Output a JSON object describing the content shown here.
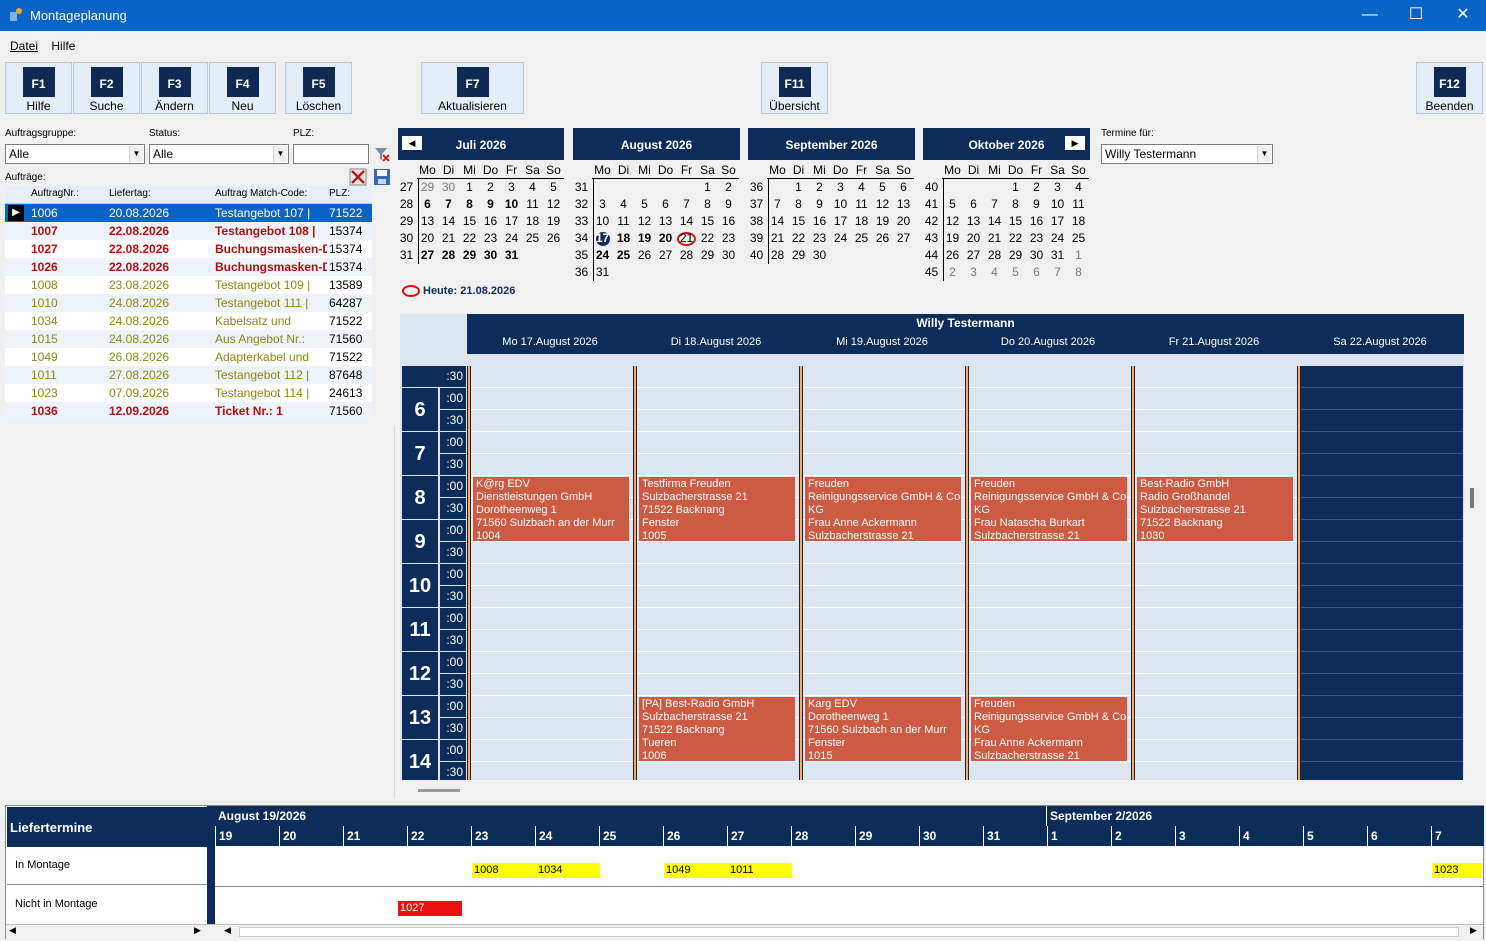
{
  "window": {
    "title": "Montageplanung",
    "min": "—",
    "max": "☐",
    "close": "✕"
  },
  "menu": [
    "Datei",
    "Hilfe"
  ],
  "toolbar": [
    {
      "key": "F1",
      "label": "Hilfe"
    },
    {
      "key": "F2",
      "label": "Suche"
    },
    {
      "key": "F3",
      "label": "Ändern"
    },
    {
      "key": "F4",
      "label": "Neu"
    },
    {
      "key": "F5",
      "label": "Löschen"
    },
    {
      "key": "F7",
      "label": "Aktualisieren"
    },
    {
      "key": "F11",
      "label": "Übersicht"
    },
    {
      "key": "F12",
      "label": "Beenden"
    }
  ],
  "filters": {
    "group_label": "Auftragsgruppe:",
    "group_value": "Alle",
    "status_label": "Status:",
    "status_value": "Alle",
    "plz_label": "PLZ:",
    "plz_value": "",
    "orders_label": "Aufträge:"
  },
  "orders": {
    "columns": [
      "AuftragNr.:",
      "Liefertag:",
      "Auftrag Match-Code:",
      "PLZ:"
    ],
    "rows": [
      [
        "1006",
        "20.08.2026",
        "Testangebot 107 |",
        "71522",
        "selected"
      ],
      [
        "1007",
        "22.08.2026",
        "Testangebot 108 |",
        "15374",
        "red"
      ],
      [
        "1027",
        "22.08.2026",
        "Buchungsmasken-De",
        "15374",
        "red"
      ],
      [
        "1026",
        "22.08.2026",
        "Buchungsmasken-De",
        "15374",
        "red"
      ],
      [
        "1008",
        "23.08.2026",
        "Testangebot 109 |",
        "13589",
        "olive"
      ],
      [
        "1010",
        "24.08.2026",
        "Testangebot 111 |",
        "64287",
        "olive"
      ],
      [
        "1034",
        "24.08.2026",
        "Kabelsatz und",
        "71522",
        "olive"
      ],
      [
        "1015",
        "24.08.2026",
        "Aus Angebot Nr.:",
        "71560",
        "olive"
      ],
      [
        "1049",
        "26.08.2026",
        "Adapterkabel und",
        "71522",
        "olive"
      ],
      [
        "1011",
        "27.08.2026",
        "Testangebot 112 |",
        "87648",
        "olive"
      ],
      [
        "1023",
        "07.09.2026",
        "Testangebot 114 |",
        "24613",
        "olive"
      ],
      [
        "1036",
        "12.09.2026",
        "Ticket Nr.: 1",
        "71560",
        "red"
      ]
    ]
  },
  "calendar": {
    "weekdays": [
      "Mo",
      "Di",
      "Mi",
      "Do",
      "Fr",
      "Sa",
      "So"
    ],
    "months": [
      {
        "title": "Juli 2026",
        "weeks": [
          "27",
          "28",
          "29",
          "30",
          "31"
        ],
        "rows": [
          [
            "29",
            "30",
            "1",
            "2",
            "3",
            "4",
            "5"
          ],
          [
            "6",
            "7",
            "8",
            "9",
            "10",
            "11",
            "12"
          ],
          [
            "13",
            "14",
            "15",
            "16",
            "17",
            "18",
            "19"
          ],
          [
            "20",
            "21",
            "22",
            "23",
            "24",
            "25",
            "26"
          ],
          [
            "27",
            "28",
            "29",
            "30",
            "31",
            "",
            ""
          ]
        ]
      },
      {
        "title": "August 2026",
        "weeks": [
          "31",
          "32",
          "33",
          "34",
          "35",
          "36"
        ],
        "rows": [
          [
            "",
            "",
            "",
            "",
            "",
            "1",
            "2"
          ],
          [
            "3",
            "4",
            "5",
            "6",
            "7",
            "8",
            "9"
          ],
          [
            "10",
            "11",
            "12",
            "13",
            "14",
            "15",
            "16"
          ],
          [
            "17",
            "18",
            "19",
            "20",
            "21",
            "22",
            "23"
          ],
          [
            "24",
            "25",
            "26",
            "27",
            "28",
            "29",
            "30"
          ],
          [
            "31",
            "",
            "",
            "",
            "",
            "",
            ""
          ]
        ]
      },
      {
        "title": "September 2026",
        "weeks": [
          "36",
          "37",
          "38",
          "39",
          "40"
        ],
        "rows": [
          [
            "",
            "1",
            "2",
            "3",
            "4",
            "5",
            "6"
          ],
          [
            "7",
            "8",
            "9",
            "10",
            "11",
            "12",
            "13"
          ],
          [
            "14",
            "15",
            "16",
            "17",
            "18",
            "19",
            "20"
          ],
          [
            "21",
            "22",
            "23",
            "24",
            "25",
            "26",
            "27"
          ],
          [
            "28",
            "29",
            "30",
            "",
            "",
            "",
            ""
          ]
        ]
      },
      {
        "title": "Oktober 2026",
        "weeks": [
          "40",
          "41",
          "42",
          "43",
          "44",
          "45"
        ],
        "rows": [
          [
            "",
            "",
            "",
            "1",
            "2",
            "3",
            "4"
          ],
          [
            "5",
            "6",
            "7",
            "8",
            "9",
            "10",
            "11"
          ],
          [
            "12",
            "13",
            "14",
            "15",
            "16",
            "17",
            "18"
          ],
          [
            "19",
            "20",
            "21",
            "22",
            "23",
            "24",
            "25"
          ],
          [
            "26",
            "27",
            "28",
            "29",
            "30",
            "31",
            "1"
          ],
          [
            "2",
            "3",
            "4",
            "5",
            "6",
            "7",
            "8"
          ]
        ]
      }
    ],
    "today": "Heute: 21.08.2026",
    "termine_label": "Termine für:",
    "termine_value": "Willy Testermann"
  },
  "week": {
    "person": "Willy Testermann",
    "days": [
      "Mo 17.August 2026",
      "Di 18.August 2026",
      "Mi 19.August 2026",
      "Do 20.August 2026",
      "Fr 21.August 2026",
      "Sa 22.August 2026"
    ],
    "hours": [
      "6",
      "7",
      "8",
      "9",
      "10",
      "11",
      "12",
      "13",
      "14"
    ],
    "events": [
      {
        "day": 0,
        "start": "8:00",
        "lines": [
          "K@rg EDV",
          "Dienstleistungen GmbH",
          "Dorotheenweg 1",
          "71560 Sulzbach an der Murr",
          "1004"
        ]
      },
      {
        "day": 1,
        "start": "8:00",
        "lines": [
          "Testfirma Freuden",
          "Sulzbacherstrasse 21",
          "71522 Backnang",
          "Fenster",
          "1005"
        ]
      },
      {
        "day": 2,
        "start": "8:00",
        "lines": [
          "Freuden",
          "Reinigungsservice GmbH & Co.",
          "KG",
          "Frau Anne Ackermann",
          "Sulzbacherstrasse 21"
        ]
      },
      {
        "day": 3,
        "start": "8:00",
        "lines": [
          "Freuden",
          "Reinigungsservice GmbH & Co.",
          "KG",
          "Frau Natascha Burkart",
          "Sulzbacherstrasse 21"
        ]
      },
      {
        "day": 4,
        "start": "8:00",
        "lines": [
          "Best-Radio GmbH",
          "Radio Großhandel",
          "Sulzbacherstrasse 21",
          "71522 Backnang",
          "1030"
        ]
      },
      {
        "day": 1,
        "start": "13:00",
        "lines": [
          "[PA] Best-Radio GmbH",
          "Sulzbacherstrasse 21",
          "71522 Backnang",
          "Tueren",
          "1006"
        ]
      },
      {
        "day": 2,
        "start": "13:00",
        "lines": [
          "Karg EDV",
          "Dorotheenweg 1",
          "71560 Sulzbach an der Murr",
          "Fenster",
          "1015"
        ]
      },
      {
        "day": 3,
        "start": "13:00",
        "lines": [
          "Freuden",
          "Reinigungsservice GmbH & Co.",
          "KG",
          "Frau Anne Ackermann",
          "Sulzbacherstrasse 21"
        ]
      }
    ]
  },
  "liefertermine": {
    "title": "Liefertermine",
    "rows": [
      "In Montage",
      "Nicht in Montage"
    ],
    "month1": "August 19/2026",
    "month2": "September 2/2026",
    "days": [
      "19",
      "20",
      "21",
      "22",
      "23",
      "24",
      "25",
      "26",
      "27",
      "28",
      "29",
      "30",
      "31",
      "1",
      "2",
      "3",
      "4",
      "5",
      "6",
      "7"
    ],
    "bars_montage": [
      "1008",
      "1034",
      "1049",
      "1011",
      "1023"
    ],
    "bars_nicht": [
      "1027"
    ]
  },
  "colors": {
    "navy": "#0c2d5a",
    "event": "#cd5a43",
    "selected": "#0a64c8",
    "red": "#b01010",
    "olive": "#8a8a10",
    "yellow": "#ffff00"
  }
}
